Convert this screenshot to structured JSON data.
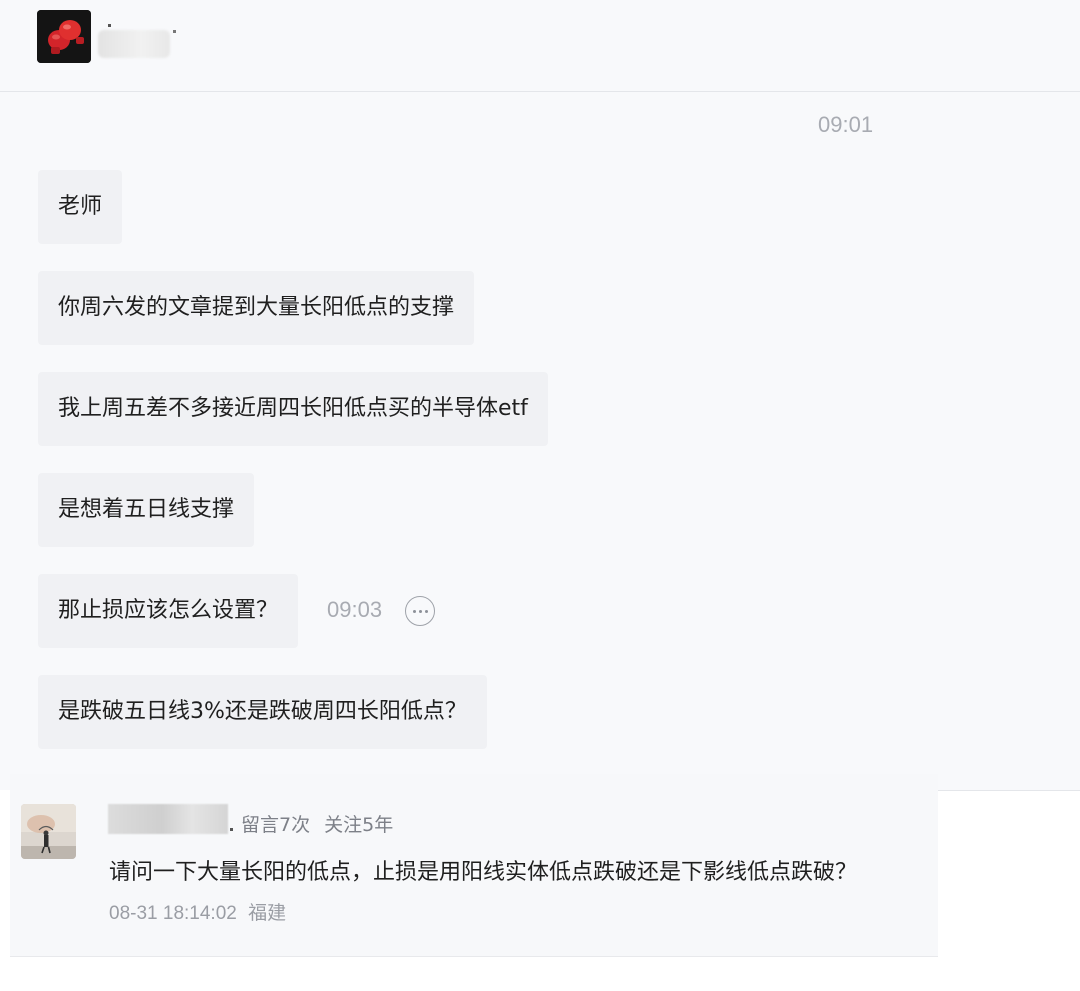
{
  "chat": {
    "header": {
      "avatar_icon": "boxing-gloves-icon"
    },
    "timestamps": {
      "first": "09:01",
      "second": "09:03"
    },
    "messages": [
      "老师",
      "你周六发的文章提到大量长阳低点的支撑",
      "我上周五差不多接近周四长阳低点买的半导体etf",
      "是想着五日线支撑",
      "那止损应该怎么设置？",
      "是跌破五日线3%还是跌破周四长阳低点？"
    ],
    "more_icon": "more-options-icon"
  },
  "comment": {
    "stats": {
      "comments": "留言7次",
      "follow": "关注5年"
    },
    "text": "请问一下大量长阳的低点，止损是用阳线实体低点跌破还是下影线低点跌破？",
    "datetime": "08-31 18:14:02",
    "location": "福建"
  },
  "colors": {
    "chat_background": "#f8f9fb",
    "bubble_background": "#f0f1f4",
    "timestamp_gray": "#a8abb2"
  }
}
